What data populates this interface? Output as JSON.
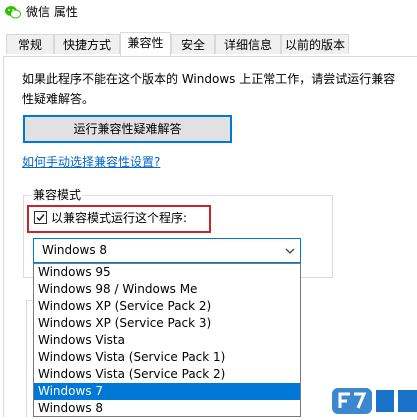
{
  "window": {
    "title": "微信 属性",
    "icon": "wechat-icon"
  },
  "tabs": [
    {
      "label": "常规"
    },
    {
      "label": "快捷方式"
    },
    {
      "label": "兼容性",
      "active": true
    },
    {
      "label": "安全"
    },
    {
      "label": "详细信息"
    },
    {
      "label": "以前的版本"
    }
  ],
  "compat": {
    "description": "如果此程序不能在这个版本的 Windows 上正常工作，请尝试运行兼容性疑难解答。",
    "troubleshoot_button": "运行兼容性疑难解答",
    "manual_link": "如何手动选择兼容性设置?",
    "group_label": "兼容模式",
    "checkbox_label": "以兼容模式运行这个程序:",
    "checkbox_checked": true,
    "selected_os": "Windows 8",
    "os_options": [
      "Windows 95",
      "Windows 98 / Windows Me",
      "Windows XP (Service Pack 2)",
      "Windows XP (Service Pack 3)",
      "Windows Vista",
      "Windows Vista (Service Pack 1)",
      "Windows Vista (Service Pack 2)",
      "Windows 7",
      "Windows 8"
    ],
    "highlighted_option_index": 7
  },
  "colors": {
    "accent": "#0078d7",
    "highlight_border": "#c62828",
    "link": "#0066cc"
  }
}
